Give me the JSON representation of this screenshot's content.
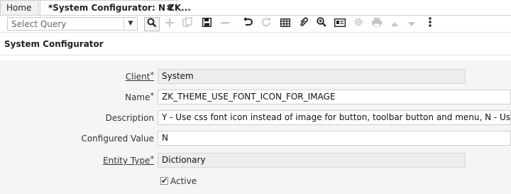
{
  "tabs": {
    "home_label": "Home",
    "active_label": "*System Configurator: N ZK...",
    "close_glyph": "✖"
  },
  "toolbar": {
    "query_placeholder": "Select Query",
    "icons": [
      "chevron-down-icon",
      "search-icon",
      "new-record-icon",
      "copy-record-icon",
      "save-icon",
      "delete-icon",
      "undo-icon",
      "refresh-icon",
      "grid-toggle-icon",
      "attachment-icon",
      "zoom-icon",
      "report-icon",
      "process-icon",
      "print-icon",
      "previous-record-icon",
      "next-record-icon",
      "more-icon"
    ]
  },
  "window": {
    "title": "System Configurator"
  },
  "form": {
    "client": {
      "label": "Client",
      "value": "System"
    },
    "name": {
      "label": "Name",
      "value": "ZK_THEME_USE_FONT_ICON_FOR_IMAGE"
    },
    "description": {
      "label": "Description",
      "value": "Y - Use css font icon instead of image for button, toolbar button and menu, N - Use image"
    },
    "configured_value": {
      "label": "Configured Value",
      "value": "N"
    },
    "entity_type": {
      "label": "Entity Type",
      "value": "Dictionary"
    },
    "active": {
      "label": "Active",
      "checked": true
    }
  }
}
